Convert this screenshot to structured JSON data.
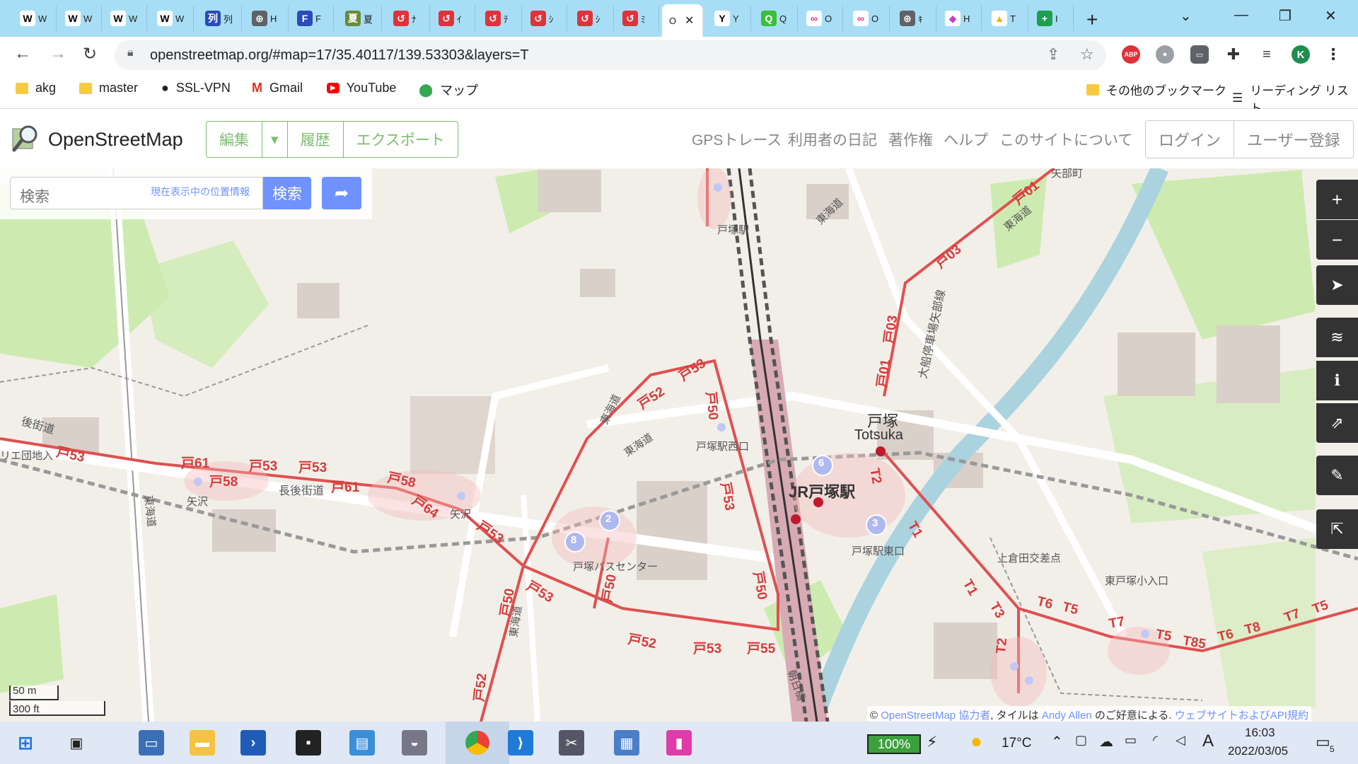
{
  "browser": {
    "tabs": [
      {
        "fav": "W",
        "title": "W",
        "color": "#ffffff",
        "fg": "#000"
      },
      {
        "fav": "W",
        "title": "W",
        "color": "#ffffff",
        "fg": "#000"
      },
      {
        "fav": "W",
        "title": "W",
        "color": "#ffffff",
        "fg": "#000"
      },
      {
        "fav": "W",
        "title": "W",
        "color": "#ffffff",
        "fg": "#000"
      },
      {
        "fav": "列",
        "title": "列",
        "color": "#2a4bb8",
        "fg": "#fff"
      },
      {
        "fav": "⊕",
        "title": "H",
        "color": "#5f6368",
        "fg": "#fff"
      },
      {
        "fav": "F",
        "title": "F",
        "color": "#2a4bb8",
        "fg": "#fff"
      },
      {
        "fav": "夏",
        "title": "夏",
        "color": "#6a8a3a",
        "fg": "#fff"
      },
      {
        "fav": "↺",
        "title": "ﾅ",
        "color": "#e0323a",
        "fg": "#fff"
      },
      {
        "fav": "↺",
        "title": "ｲ",
        "color": "#e0323a",
        "fg": "#fff"
      },
      {
        "fav": "↺",
        "title": "ﾃ",
        "color": "#e0323a",
        "fg": "#fff"
      },
      {
        "fav": "↺",
        "title": "ｼ",
        "color": "#e0323a",
        "fg": "#fff"
      },
      {
        "fav": "↺",
        "title": "ｼ",
        "color": "#e0323a",
        "fg": "#fff"
      },
      {
        "fav": "↺",
        "title": "ﾐ",
        "color": "#e0323a",
        "fg": "#fff"
      },
      {
        "fav": "Y",
        "title": "Y",
        "color": "#ffffff",
        "fg": "#000"
      },
      {
        "fav": "Q",
        "title": "Q",
        "color": "#3bbf3b",
        "fg": "#fff"
      },
      {
        "fav": "∞",
        "title": "O",
        "color": "#ffffff",
        "fg": "#d63b8a"
      },
      {
        "fav": "∞",
        "title": "O",
        "color": "#ffffff",
        "fg": "#d63b8a"
      },
      {
        "fav": "⊕",
        "title": "ｷ",
        "color": "#5f6368",
        "fg": "#fff"
      },
      {
        "fav": "◆",
        "title": "H",
        "color": "#ffffff",
        "fg": "#c23bd6"
      },
      {
        "fav": "▲",
        "title": "T",
        "color": "#ffffff",
        "fg": "#f4b400"
      },
      {
        "fav": "+",
        "title": "I",
        "color": "#1e9e50",
        "fg": "#fff"
      }
    ],
    "active_tab_title": "O",
    "url": "openstreetmap.org/#map=17/35.40117/139.53303&layers=T",
    "bookmarks": [
      {
        "label": "akg",
        "icon": "folder"
      },
      {
        "label": "master",
        "icon": "folder"
      },
      {
        "label": "SSL-VPN",
        "icon": "globe"
      },
      {
        "label": "Gmail",
        "icon": "gmail"
      },
      {
        "label": "YouTube",
        "icon": "youtube"
      },
      {
        "label": "マップ",
        "icon": "maps"
      }
    ],
    "other_bookmarks": "その他のブックマーク",
    "reading_list": "リーディング リスト",
    "profile_initial": "K",
    "abp_label": "ABP"
  },
  "osm": {
    "site_title": "OpenStreetMap",
    "edit": "編集",
    "history": "履歴",
    "export": "エクスポート",
    "nav": [
      "GPSトレース",
      "利用者の日記",
      "著作権",
      "ヘルプ",
      "このサイトについて"
    ],
    "login": "ログイン",
    "signup": "ユーザー登録",
    "search_placeholder": "検索",
    "where_am_i": "現在表示中の位置情報",
    "search_button": "検索",
    "scale_m": "50 m",
    "scale_ft": "300 ft",
    "attribution": {
      "prefix": "© ",
      "osm": "OpenStreetMap 協力者",
      "mid1": ", タイルは ",
      "andy": "Andy Allen",
      "mid2": " のご好意による. ",
      "site": "ウェブサイトおよびAPI規約"
    }
  },
  "map_labels": {
    "station_jp": "JR戸塚駅",
    "totsuka_kanji": "戸塚",
    "totsuka_romaji": "Totsuka",
    "nishiguchi": "戸塚駅西口",
    "higashiguchi": "戸塚駅東口",
    "bus_center": "戸塚バスセンター",
    "yazawa1": "矢沢",
    "yazawa2": "矢沢",
    "nagao": "長後街道",
    "nagao2": "後街道",
    "tokaido1": "東海道",
    "tokaido2": "東海道",
    "tokaido3": "東海道",
    "tokaido4": "東海道",
    "tokaido5": "東海道",
    "tokaido6": "東海道",
    "ofuna": "大船停車場矢部線",
    "kamikura": "上倉田交差点",
    "higashi_totsuka": "東戸塚小入口",
    "totsuka_eki_top": "戸塚駅",
    "yabe": "矢部町",
    "danchi": "リエ団地入",
    "asahi": "朝日橋",
    "routes": {
      "r1": "戸01",
      "r3": "戸03",
      "r3b": "戸03",
      "r1b": "戸01",
      "r53a": "戸53",
      "r53b": "戸53",
      "r53c": "戸53",
      "r53d": "戸53",
      "r53e": "戸53",
      "r53f": "戸53",
      "r53g": "戸53",
      "r61a": "戸61",
      "r61b": "戸61",
      "r58a": "戸58",
      "r58b": "戸58",
      "r64": "戸64",
      "r52a": "戸52",
      "r52b": "戸52",
      "r52c": "戸52",
      "r50a": "戸50",
      "r50b": "戸50",
      "r50c": "戸50",
      "r50d": "戸50",
      "r55": "戸55",
      "t1": "T1",
      "t1b": "T1",
      "t2": "T2",
      "t2b": "T2",
      "t3": "T3",
      "t5": "T5",
      "t5b": "T5",
      "t5c": "T5",
      "t6": "T6",
      "t6b": "T6",
      "t7": "T7",
      "t7b": "T7",
      "t8": "T8",
      "t85": "T85"
    },
    "stop_numbers": [
      "6",
      "2",
      "8",
      "3"
    ]
  },
  "taskbar": {
    "battery": "100%",
    "temperature": "17°C",
    "ime": "A",
    "time": "16:03",
    "date": "2022/03/05",
    "notifications": "5"
  },
  "colors": {
    "osm_green": "#7ebc6f",
    "osm_blue": "#7092ff",
    "route_red": "#e05050",
    "tabstrip": "#a7def5"
  }
}
